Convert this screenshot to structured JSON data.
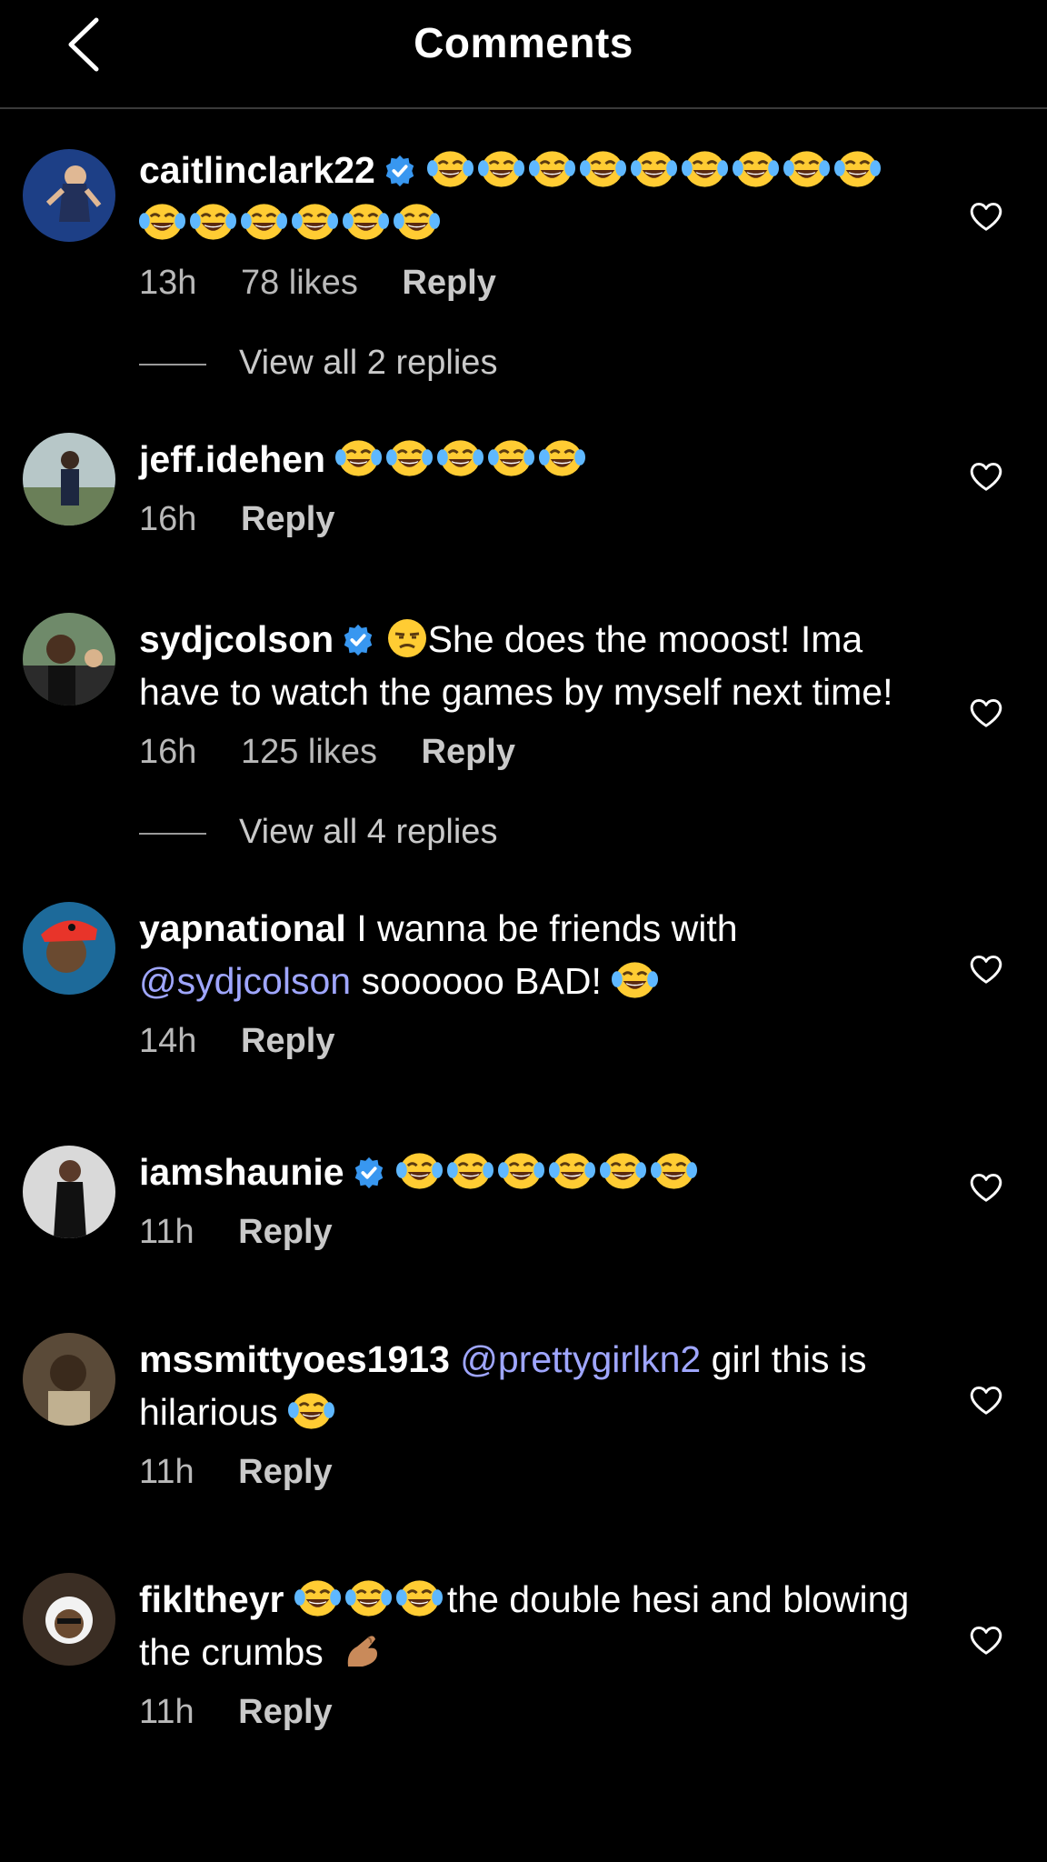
{
  "header": {
    "title": "Comments"
  },
  "comments": [
    {
      "username": "caitlinclark22",
      "text": "",
      "emoji_count": 15,
      "time": "13h",
      "likes": "78 likes",
      "reply_label": "Reply",
      "view_replies": "View all 2 replies"
    },
    {
      "username": "jeff.idehen",
      "text": "",
      "emoji_count": 5,
      "time": "16h",
      "reply_label": "Reply"
    },
    {
      "username": "sydjcolson",
      "text": "She does the mooost! Ima have to watch the games by myself next time!",
      "time": "16h",
      "likes": "125 likes",
      "reply_label": "Reply",
      "view_replies": "View all 4 replies"
    },
    {
      "username": "yapnational",
      "text_before": "I wanna be friends with",
      "mention": "@sydjcolson",
      "text_after": "soooooo BAD!",
      "time": "14h",
      "reply_label": "Reply"
    },
    {
      "username": "iamshaunie",
      "emoji_count": 6,
      "time": "11h",
      "reply_label": "Reply"
    },
    {
      "username": "mssmittyoes1913",
      "mention": "@prettygirlkn2",
      "text_after": "girl this is hilarious",
      "time": "11h",
      "reply_label": "Reply"
    },
    {
      "username": "fikltheyr",
      "emoji_count": 3,
      "text_after": "the double hesi and blowing the crumbs",
      "time": "11h",
      "reply_label": "Reply"
    }
  ],
  "colors": {
    "background": "#000000",
    "mention": "#9fa6ff",
    "verified": "#3897f0",
    "meta": "#b9b9b9"
  },
  "icons": {
    "back": "chevron-left-icon",
    "verified": "verified-badge-icon",
    "like": "heart-outline-icon",
    "laugh": "tears-of-joy-emoji",
    "unamused": "unamused-face-emoji",
    "pinch": "pinching-hand-emoji"
  }
}
